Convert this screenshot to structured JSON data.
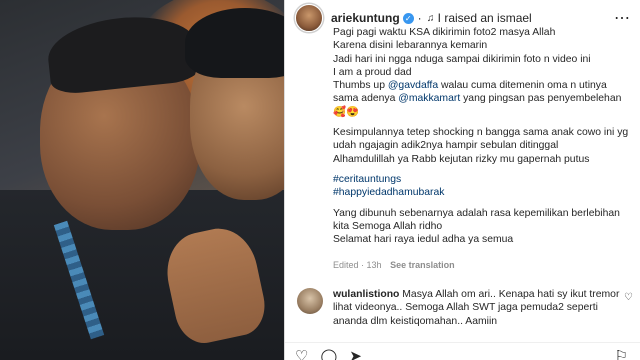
{
  "post": {
    "username": "ariekuntung",
    "audio": "I raised an ismael",
    "caption_lines": [
      "Pagi pagi waktu KSA dikirimin foto2 masya Allah",
      "Karena disini lebarannya kemarin",
      "Jadi hari ini ngga nduga sampai dikirimin foto n video ini",
      "I am a proud dad"
    ],
    "thumbs_pre": "Thumbs up ",
    "mention_1": "@gavdaffa",
    "thumbs_mid": " walau cuma ditemenin oma n utinya",
    "thumbs_line2_pre": "sama adenya ",
    "mention_2": "@makkamart",
    "thumbs_line2_post": " yang pingsan pas penyembelehan",
    "emoji_line": "🥰😍",
    "paragraph_2": [
      "Kesimpulannya tetep shocking n bangga sama anak cowo ini yg",
      "udah ngajagin adik2nya hampir sebulan ditinggal",
      "Alhamdulillah ya Rabb kejutan rizky mu gapernah putus"
    ],
    "hashtags": [
      "#ceritauntungs",
      "#happyiedadhamubarak"
    ],
    "paragraph_3": [
      "Yang dibunuh sebenarnya adalah rasa kepemilikan berlebihan",
      "kita Semoga Allah ridho",
      "Selamat hari raya iedul adha ya semua"
    ],
    "meta": {
      "edited": "Edited · 13h",
      "see_translation": "See translation"
    }
  },
  "comment": {
    "username": "wulanlistiono",
    "lines": [
      " Masya Allah om ari.. Kenapa hati sy ikut tremor",
      "lihat videonya.. Semoga Allah SWT jaga pemuda2 seperti",
      "ananda dlm keistiqomahan.. Aamiin"
    ]
  },
  "icons": {
    "verified": "verified-badge-icon",
    "more": "more-options-icon",
    "heart": "heart-icon",
    "comment": "comment-icon",
    "share": "share-icon",
    "bookmark": "bookmark-icon"
  },
  "colors": {
    "link": "#00376b",
    "verified": "#3897f0",
    "muted": "#8e8e8e"
  }
}
